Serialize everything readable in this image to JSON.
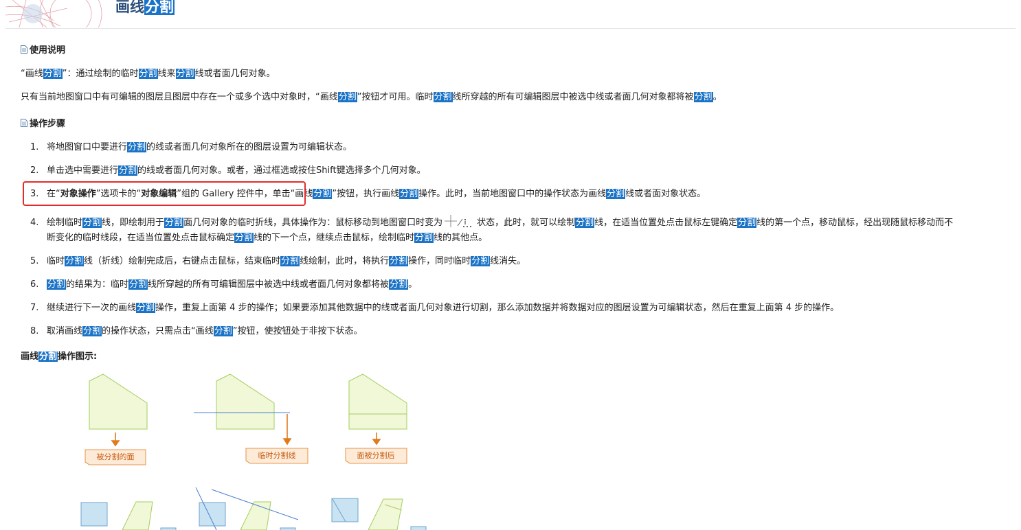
{
  "header": {
    "title_prefix": "画线",
    "title_hl": "分割"
  },
  "usage": {
    "heading": "使用说明",
    "line1": [
      [
        "“画线",
        false
      ],
      [
        "分割",
        true
      ],
      [
        "”：通过绘制的临时",
        false
      ],
      [
        "分割",
        true
      ],
      [
        "线来",
        false
      ],
      [
        "分割",
        true
      ],
      [
        "线或者面几何对象。",
        false
      ]
    ],
    "line2": [
      [
        "只有当前地图窗口中有可编辑的图层且图层中存在一个或多个选中对象时，“画线",
        false
      ],
      [
        "分割",
        true
      ],
      [
        "”按钮才可用。临时",
        false
      ],
      [
        "分割",
        true
      ],
      [
        "线所穿越的所有可编辑图层中被选中线或者面几何对象都将被",
        false
      ],
      [
        "分割",
        true
      ],
      [
        "。",
        false
      ]
    ]
  },
  "steps": {
    "heading": "操作步骤",
    "items": [
      {
        "num": "1.",
        "segs": [
          [
            "将地图窗口中要进行",
            false
          ],
          [
            "分割",
            true
          ],
          [
            "的线或者面几何对象所在的图层设置为可编辑状态。",
            false
          ]
        ]
      },
      {
        "num": "2.",
        "segs": [
          [
            "单击选中需要进行",
            false
          ],
          [
            "分割",
            true
          ],
          [
            "的线或者面几何对象。或者，通过框选或按住Shift键选择多个几何对象。",
            false
          ]
        ]
      },
      {
        "num": "3.",
        "segs": [
          [
            "在“",
            false
          ],
          [
            "对象操作",
            false,
            "b"
          ],
          [
            "”选项卡的“",
            false
          ],
          [
            "对象编辑",
            false,
            "b"
          ],
          [
            "”组的 Gallery 控件中，单击“画线",
            false
          ],
          [
            "分割",
            true
          ],
          [
            "”按钮，执行画线",
            false
          ],
          [
            "分割",
            true
          ],
          [
            "操作。此时，当前地图窗口中的操作状态为画线",
            false
          ],
          [
            "分割",
            true
          ],
          [
            "线或者面对象状态。",
            false
          ]
        ]
      },
      {
        "num": "4.",
        "segs": [
          [
            "绘制临时",
            false
          ],
          [
            "分割",
            true
          ],
          [
            "线，即绘制用于",
            false
          ],
          [
            "分割",
            true
          ],
          [
            "面几何对象的临时折线，具体操作为：鼠标移动到地图窗口时变为",
            false
          ]
        ]
      },
      {
        "num": "5.",
        "segs": [
          [
            "临时",
            false
          ],
          [
            "分割",
            true
          ],
          [
            "线（折线）绘制完成后，右键点击鼠标，结束临时",
            false
          ],
          [
            "分割",
            true
          ],
          [
            "线绘制，此时，将执行",
            false
          ],
          [
            "分割",
            true
          ],
          [
            "操作，同时临时",
            false
          ],
          [
            "分割",
            true
          ],
          [
            "线消失。",
            false
          ]
        ]
      },
      {
        "num": "6.",
        "segs": [
          [
            "分割",
            true
          ],
          [
            "的结果为：临时",
            false
          ],
          [
            "分割",
            true
          ],
          [
            "线所穿越的所有可编辑图层中被选中线或者面几何对象都将被",
            false
          ],
          [
            "分割",
            true
          ],
          [
            "。",
            false
          ]
        ]
      },
      {
        "num": "7.",
        "segs": [
          [
            "继续进行下一次的画线",
            false
          ],
          [
            "分割",
            true
          ],
          [
            "操作，重复上面第 4 步的操作；如果要添加其他数据中的线或者面几何对象进行切割，那么添加数据并将数据对应的图层设置为可编辑状态，然后在重复上面第 4 步的操作。",
            false
          ]
        ]
      },
      {
        "num": "8.",
        "segs": [
          [
            "取消画线",
            false
          ],
          [
            "分割",
            true
          ],
          [
            "的操作状态，只需点击“画线",
            false
          ],
          [
            "分割",
            true
          ],
          [
            "”按钮，使按钮处于非按下状态。",
            false
          ]
        ]
      }
    ],
    "step4_cont": [
      [
        "状态，此时，就可以绘制",
        false
      ],
      [
        "分割",
        true
      ],
      [
        "线，在适当位置处点击鼠标左键确定",
        false
      ],
      [
        "分割",
        true
      ],
      [
        "线的第一个点，移动鼠标，经出现随鼠标移动而不",
        false
      ]
    ],
    "step4_line2": [
      [
        "断变化的临时线段，在适当位置处点击鼠标确定",
        false
      ],
      [
        "分割",
        true
      ],
      [
        "线的下一个点，继续点击鼠标，绘制临时",
        false
      ],
      [
        "分割",
        true
      ],
      [
        "线的其他点。",
        false
      ]
    ]
  },
  "figure": {
    "caption": [
      [
        "画线",
        false
      ],
      [
        "分割",
        true
      ],
      [
        "操作图示:",
        false
      ]
    ],
    "labels": [
      "被分割的面",
      "临时分割线",
      "面被分割后"
    ]
  },
  "colors": {
    "highlight": "#1a73c7",
    "polygon_fill": "#f0f8d8",
    "polygon_stroke": "#a6cc5c",
    "line": "#4a7fd1",
    "arrow": "#e07a1c",
    "callout_fill": "#fdebd8",
    "callout_stroke": "#e07a1c",
    "square_fill": "#c9e3f3",
    "square_stroke": "#6fa3cc"
  }
}
